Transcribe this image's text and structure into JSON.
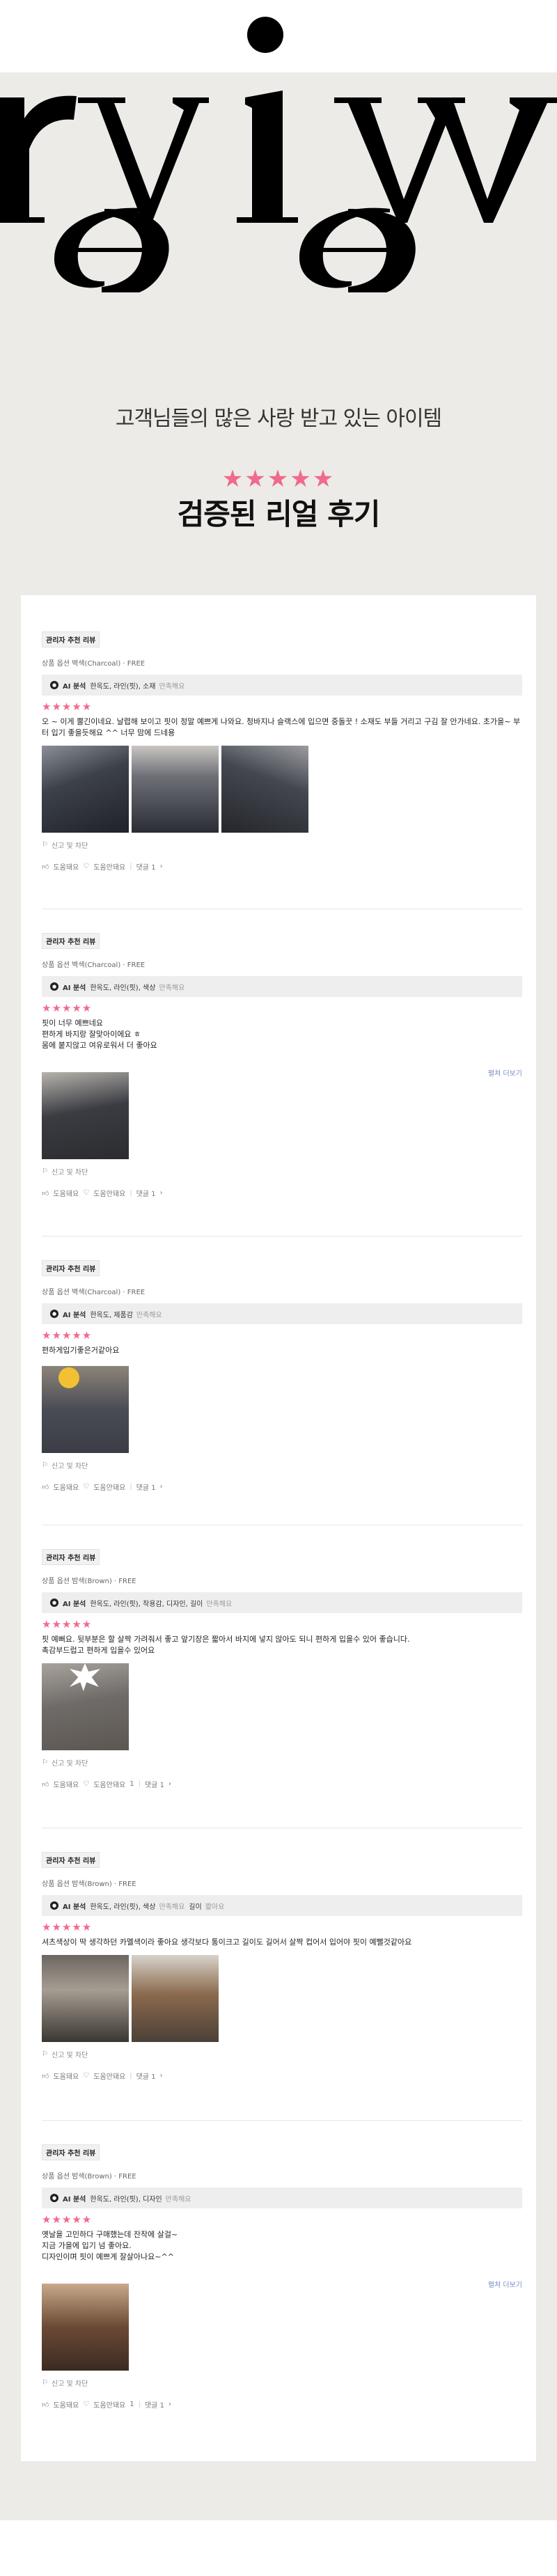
{
  "hero": {
    "banner_word": "review",
    "subtitle": "고객님들의 많은 사랑 받고 있는 아이템",
    "stars": "★★★★★",
    "heading": "검증된 리얼 후기"
  },
  "colors": {
    "accent_pink": "#f06a8c",
    "background": "#ecebe7",
    "link_blue": "#7b8fc4"
  },
  "common": {
    "badge": "관리자 추천 리뷰",
    "report_label": "신고 및 차단",
    "helpful_label": "도움돼요",
    "unhelpful_label": "도움안돼요",
    "more_label": "펼쳐 더보기",
    "ai_label": "AI 분석"
  },
  "reviews": [
    {
      "product": "상품 옵션 벽색(Charcoal) · FREE",
      "ai_aspects": "한옥도, 라인(핏), 소재",
      "ai_verdict": "만족해요",
      "stars": "★★★★★",
      "content": "오 ~ 이게 뿔긴이네요. 날렵해 보이고 핏이 정말 예쁘게 나와요. 청바지나 슬랙스에 입으면 중돌꿋 ! 소재도 부들 거리고 구김 잘 안가네요. 초가을~ 부터 입기 좋을듯해요 ^^ 너무 맘에 드네용",
      "unhelpful_count": "",
      "comment": "댓글 1"
    },
    {
      "product": "상품 옵션 벽색(Charcoal) · FREE",
      "ai_aspects": "한옥도, 라인(핏), 색상",
      "ai_verdict": "만족해요",
      "stars": "★★★★★",
      "content": "핏이 너무 예쁘네요\n편하게 바지랑 잘맞아이에요 ㅎ\n몸에 붙지않고 여유로워서 더 좋아요",
      "unhelpful_count": "",
      "comment": "댓글 1"
    },
    {
      "product": "상품 옵션 벽색(Charcoal) · FREE",
      "ai_aspects": "한옥도, 제품감",
      "ai_verdict": "만족해요",
      "stars": "★★★★★",
      "content": "편하게입기좋은거같아요",
      "unhelpful_count": "",
      "comment": "댓글 1"
    },
    {
      "product": "상품 옵션 밤색(Brown) · FREE",
      "ai_aspects": "한옥도, 라인(핏), 착용감, 디자인, 길이",
      "ai_verdict": "만족해요",
      "stars": "★★★★★",
      "content": "핏 예뻐요. 뒷부분은 할 살짝 가려줘서 좋고 앞기장은 짧아서 바지에 넣지 않아도 되니 편하게 입을수 있어 좋습니다.\n촉감부드럽고 편하게 입을수 있어요",
      "unhelpful_count": "1",
      "comment": "댓글 1"
    },
    {
      "product": "상품 옵션 밤색(Brown) · FREE",
      "ai_aspects": "한옥도, 라인(핏), 색상",
      "ai_verdict": "만족해요",
      "ai_extra": "길이",
      "ai_extra_verdict": "짧아요",
      "stars": "★★★★★",
      "content": "셔츠색상이 딱 생각하던 카멜색이라 좋아요 생각보다 통이크고 길이도 길어서 살짝 컵어서 입어야 핏이 예뻘것같아요",
      "unhelpful_count": "",
      "comment": "댓글 1"
    },
    {
      "product": "상품 옵션 밤색(Brown) · FREE",
      "ai_aspects": "한옥도, 라인(핏), 디자인",
      "ai_verdict": "만족해요",
      "stars": "★★★★★",
      "content": "옛날을 고민하다 구매했는데 잔작에 살걸~\n지금 가을에 입기 넘 좋아요.\n디자인이며 핏이 예쁘게 잘살아나요~^^",
      "unhelpful_count": "1",
      "comment": "댓글 1"
    }
  ]
}
